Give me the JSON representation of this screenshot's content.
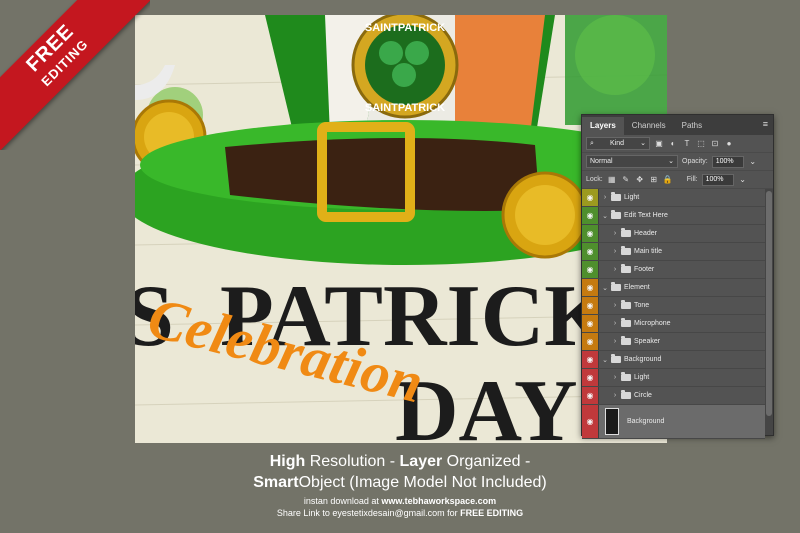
{
  "ribbon": {
    "line1": "FREE",
    "line2": "EDITING",
    "color": "#c4171f"
  },
  "artwork": {
    "badge_top": "SAINTPATRICK",
    "badge_bottom": "SAINTPATRICK",
    "title_line1": "PATRICK'S",
    "title_line2": "DAY",
    "script_text": "Celebration",
    "prefix_letter": "S"
  },
  "panel": {
    "tabs": [
      "Layers",
      "Channels",
      "Paths"
    ],
    "kind_label": "Kind",
    "blend_mode": "Normal",
    "opacity_label": "Opacity:",
    "opacity_value": "100%",
    "lock_label": "Lock:",
    "fill_label": "Fill:",
    "fill_value": "100%",
    "layers": [
      {
        "name": "Light",
        "color": "#9c9a1f",
        "indent": 0,
        "expanded": false
      },
      {
        "name": "Edit Text Here",
        "color": "#4f8f2d",
        "indent": 0,
        "expanded": true
      },
      {
        "name": "Header",
        "color": "#4f8f2d",
        "indent": 1,
        "expanded": false
      },
      {
        "name": "Main title",
        "color": "#4f8f2d",
        "indent": 1,
        "expanded": false
      },
      {
        "name": "Footer",
        "color": "#4f8f2d",
        "indent": 1,
        "expanded": false
      },
      {
        "name": "Element",
        "color": "#c57a10",
        "indent": 0,
        "expanded": true
      },
      {
        "name": "Tone",
        "color": "#c57a10",
        "indent": 1,
        "expanded": false
      },
      {
        "name": "Microphone",
        "color": "#c57a10",
        "indent": 1,
        "expanded": false
      },
      {
        "name": "Speaker",
        "color": "#c57a10",
        "indent": 1,
        "expanded": false
      },
      {
        "name": "Background",
        "color": "#c0393b",
        "indent": 0,
        "expanded": true
      },
      {
        "name": "Light",
        "color": "#c0393b",
        "indent": 1,
        "expanded": false
      },
      {
        "name": "Circle",
        "color": "#c0393b",
        "indent": 1,
        "expanded": false
      }
    ],
    "bg_layer": {
      "name": "Background",
      "color": "#c0393b"
    }
  },
  "caption": {
    "l1_a": "High",
    "l1_b": " Resolution - ",
    "l1_c": "Layer",
    "l1_d": " Organized -",
    "l2_a": "Smart",
    "l2_b": "Object (Image Model Not Included)",
    "l3_a": "instan download at ",
    "l3_b": "www.tebhaworkspace.com",
    "l4_a": "Share Link to eyestetixdesain@gmail.com for ",
    "l4_b": "FREE EDITING"
  }
}
